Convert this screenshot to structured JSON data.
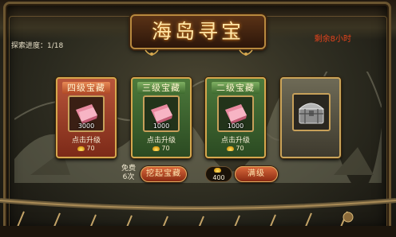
{
  "header": {
    "title": "海岛寻宝",
    "progress_label": "探索进度：1/18",
    "remaining_label": "剩余8小时"
  },
  "cards": [
    {
      "title": "四级宝藏",
      "theme": "red",
      "item_icon": "pink-silk-icon",
      "quantity": "3000",
      "upgrade_label": "点击升级",
      "cost": "70"
    },
    {
      "title": "三级宝藏",
      "theme": "green",
      "item_icon": "pink-silk-icon",
      "quantity": "1000",
      "upgrade_label": "点击升级",
      "cost": "70"
    },
    {
      "title": "二级宝藏",
      "theme": "green",
      "item_icon": "pink-silk-icon",
      "quantity": "1000",
      "upgrade_label": "点击升级",
      "cost": "70"
    },
    {
      "title": "",
      "theme": "grey",
      "item_icon": "treasure-chest-icon",
      "quantity": "",
      "upgrade_label": "",
      "cost": ""
    }
  ],
  "actions": {
    "free_label_line1": "免费",
    "free_label_line2": "6次",
    "dig_button": "挖起宝藏",
    "max_cost": "400",
    "max_button": "满级"
  },
  "colors": {
    "title_text": "#ffe7a8",
    "remaining_text": "#e8431c",
    "card_red": "#9b3f26",
    "card_green": "#3e6a2e",
    "gold_border": "#d5a74e"
  }
}
